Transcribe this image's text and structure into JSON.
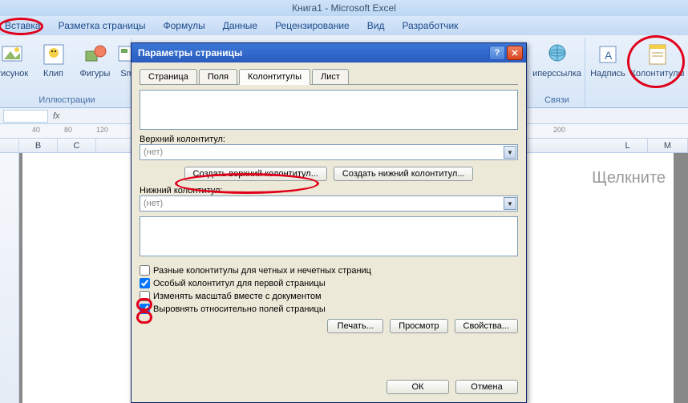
{
  "app_title": "Книга1 - Microsoft Excel",
  "tabs": {
    "insert": "Вставка",
    "page_layout": "Разметка страницы",
    "formulas": "Формулы",
    "data": "Данные",
    "review": "Рецензирование",
    "view": "Вид",
    "developer": "Разработчик"
  },
  "ribbon": {
    "picture": "Рисунок",
    "clip": "Клип",
    "shapes": "Фигуры",
    "smartart": "Sma",
    "illustrations": "Иллюстрации",
    "hyperlink": "иперссылка",
    "links": "Связи",
    "textbox": "Надпись",
    "header_footer": "Колонтитулы"
  },
  "ruler": {
    "m1": "40",
    "m2": "80",
    "m3": "120",
    "m4": "200"
  },
  "columns": [
    "",
    "B",
    "C",
    "L",
    "M"
  ],
  "sheet_hint": "Щелкните",
  "dialog": {
    "title": "Параметры страницы",
    "tabs": {
      "page": "Страница",
      "margins": "Поля",
      "hf": "Колонтитулы",
      "sheet": "Лист"
    },
    "top_label": "Верхний колонтитул:",
    "none": "(нет)",
    "create_top": "Создать верхний колонтитул...",
    "create_bottom": "Создать нижний колонтитул...",
    "bottom_label": "Нижний колонтитул:",
    "opt_odd_even": "Разные колонтитулы для четных и нечетных страниц",
    "opt_first": "Особый колонтитул для первой страницы",
    "opt_scale": "Изменять масштаб вместе с документом",
    "opt_align": "Выровнять относительно полей страницы",
    "print": "Печать...",
    "preview": "Просмотр",
    "properties": "Свойства...",
    "ok": "ОК",
    "cancel": "Отмена"
  }
}
